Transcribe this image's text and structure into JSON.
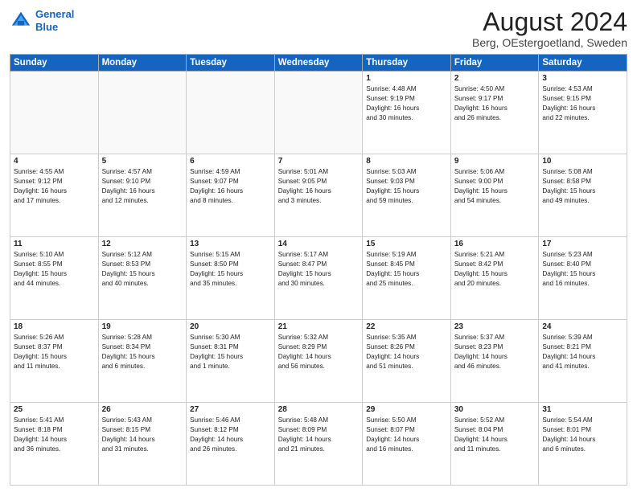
{
  "header": {
    "logo_line1": "General",
    "logo_line2": "Blue",
    "month_title": "August 2024",
    "location": "Berg, OEstergoetland, Sweden"
  },
  "weekdays": [
    "Sunday",
    "Monday",
    "Tuesday",
    "Wednesday",
    "Thursday",
    "Friday",
    "Saturday"
  ],
  "weeks": [
    [
      {
        "day": "",
        "info": ""
      },
      {
        "day": "",
        "info": ""
      },
      {
        "day": "",
        "info": ""
      },
      {
        "day": "",
        "info": ""
      },
      {
        "day": "1",
        "info": "Sunrise: 4:48 AM\nSunset: 9:19 PM\nDaylight: 16 hours\nand 30 minutes."
      },
      {
        "day": "2",
        "info": "Sunrise: 4:50 AM\nSunset: 9:17 PM\nDaylight: 16 hours\nand 26 minutes."
      },
      {
        "day": "3",
        "info": "Sunrise: 4:53 AM\nSunset: 9:15 PM\nDaylight: 16 hours\nand 22 minutes."
      }
    ],
    [
      {
        "day": "4",
        "info": "Sunrise: 4:55 AM\nSunset: 9:12 PM\nDaylight: 16 hours\nand 17 minutes."
      },
      {
        "day": "5",
        "info": "Sunrise: 4:57 AM\nSunset: 9:10 PM\nDaylight: 16 hours\nand 12 minutes."
      },
      {
        "day": "6",
        "info": "Sunrise: 4:59 AM\nSunset: 9:07 PM\nDaylight: 16 hours\nand 8 minutes."
      },
      {
        "day": "7",
        "info": "Sunrise: 5:01 AM\nSunset: 9:05 PM\nDaylight: 16 hours\nand 3 minutes."
      },
      {
        "day": "8",
        "info": "Sunrise: 5:03 AM\nSunset: 9:03 PM\nDaylight: 15 hours\nand 59 minutes."
      },
      {
        "day": "9",
        "info": "Sunrise: 5:06 AM\nSunset: 9:00 PM\nDaylight: 15 hours\nand 54 minutes."
      },
      {
        "day": "10",
        "info": "Sunrise: 5:08 AM\nSunset: 8:58 PM\nDaylight: 15 hours\nand 49 minutes."
      }
    ],
    [
      {
        "day": "11",
        "info": "Sunrise: 5:10 AM\nSunset: 8:55 PM\nDaylight: 15 hours\nand 44 minutes."
      },
      {
        "day": "12",
        "info": "Sunrise: 5:12 AM\nSunset: 8:53 PM\nDaylight: 15 hours\nand 40 minutes."
      },
      {
        "day": "13",
        "info": "Sunrise: 5:15 AM\nSunset: 8:50 PM\nDaylight: 15 hours\nand 35 minutes."
      },
      {
        "day": "14",
        "info": "Sunrise: 5:17 AM\nSunset: 8:47 PM\nDaylight: 15 hours\nand 30 minutes."
      },
      {
        "day": "15",
        "info": "Sunrise: 5:19 AM\nSunset: 8:45 PM\nDaylight: 15 hours\nand 25 minutes."
      },
      {
        "day": "16",
        "info": "Sunrise: 5:21 AM\nSunset: 8:42 PM\nDaylight: 15 hours\nand 20 minutes."
      },
      {
        "day": "17",
        "info": "Sunrise: 5:23 AM\nSunset: 8:40 PM\nDaylight: 15 hours\nand 16 minutes."
      }
    ],
    [
      {
        "day": "18",
        "info": "Sunrise: 5:26 AM\nSunset: 8:37 PM\nDaylight: 15 hours\nand 11 minutes."
      },
      {
        "day": "19",
        "info": "Sunrise: 5:28 AM\nSunset: 8:34 PM\nDaylight: 15 hours\nand 6 minutes."
      },
      {
        "day": "20",
        "info": "Sunrise: 5:30 AM\nSunset: 8:31 PM\nDaylight: 15 hours\nand 1 minute."
      },
      {
        "day": "21",
        "info": "Sunrise: 5:32 AM\nSunset: 8:29 PM\nDaylight: 14 hours\nand 56 minutes."
      },
      {
        "day": "22",
        "info": "Sunrise: 5:35 AM\nSunset: 8:26 PM\nDaylight: 14 hours\nand 51 minutes."
      },
      {
        "day": "23",
        "info": "Sunrise: 5:37 AM\nSunset: 8:23 PM\nDaylight: 14 hours\nand 46 minutes."
      },
      {
        "day": "24",
        "info": "Sunrise: 5:39 AM\nSunset: 8:21 PM\nDaylight: 14 hours\nand 41 minutes."
      }
    ],
    [
      {
        "day": "25",
        "info": "Sunrise: 5:41 AM\nSunset: 8:18 PM\nDaylight: 14 hours\nand 36 minutes."
      },
      {
        "day": "26",
        "info": "Sunrise: 5:43 AM\nSunset: 8:15 PM\nDaylight: 14 hours\nand 31 minutes."
      },
      {
        "day": "27",
        "info": "Sunrise: 5:46 AM\nSunset: 8:12 PM\nDaylight: 14 hours\nand 26 minutes."
      },
      {
        "day": "28",
        "info": "Sunrise: 5:48 AM\nSunset: 8:09 PM\nDaylight: 14 hours\nand 21 minutes."
      },
      {
        "day": "29",
        "info": "Sunrise: 5:50 AM\nSunset: 8:07 PM\nDaylight: 14 hours\nand 16 minutes."
      },
      {
        "day": "30",
        "info": "Sunrise: 5:52 AM\nSunset: 8:04 PM\nDaylight: 14 hours\nand 11 minutes."
      },
      {
        "day": "31",
        "info": "Sunrise: 5:54 AM\nSunset: 8:01 PM\nDaylight: 14 hours\nand 6 minutes."
      }
    ]
  ]
}
